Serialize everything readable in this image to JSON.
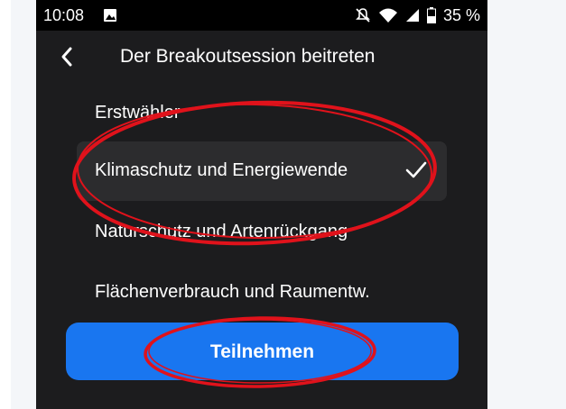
{
  "status_bar": {
    "time": "10:08",
    "battery": "35 %"
  },
  "header": {
    "back_icon": "chevron-left-icon",
    "title": "Der Breakoutsession beitreten"
  },
  "sessions": [
    {
      "label": "Erstwähler",
      "selected": false
    },
    {
      "label": "Klimaschutz und Energiewende",
      "selected": true
    },
    {
      "label": "Naturschutz und Artenrückgang",
      "selected": false
    },
    {
      "label": "Flächenverbrauch und Raumentw.",
      "selected": false
    }
  ],
  "join_button": {
    "label": "Teilnehmen"
  },
  "colors": {
    "accent": "#1976f0",
    "background": "#1c1c1e",
    "selected_row": "#2c2c2e",
    "annotation": "#e0121b"
  }
}
